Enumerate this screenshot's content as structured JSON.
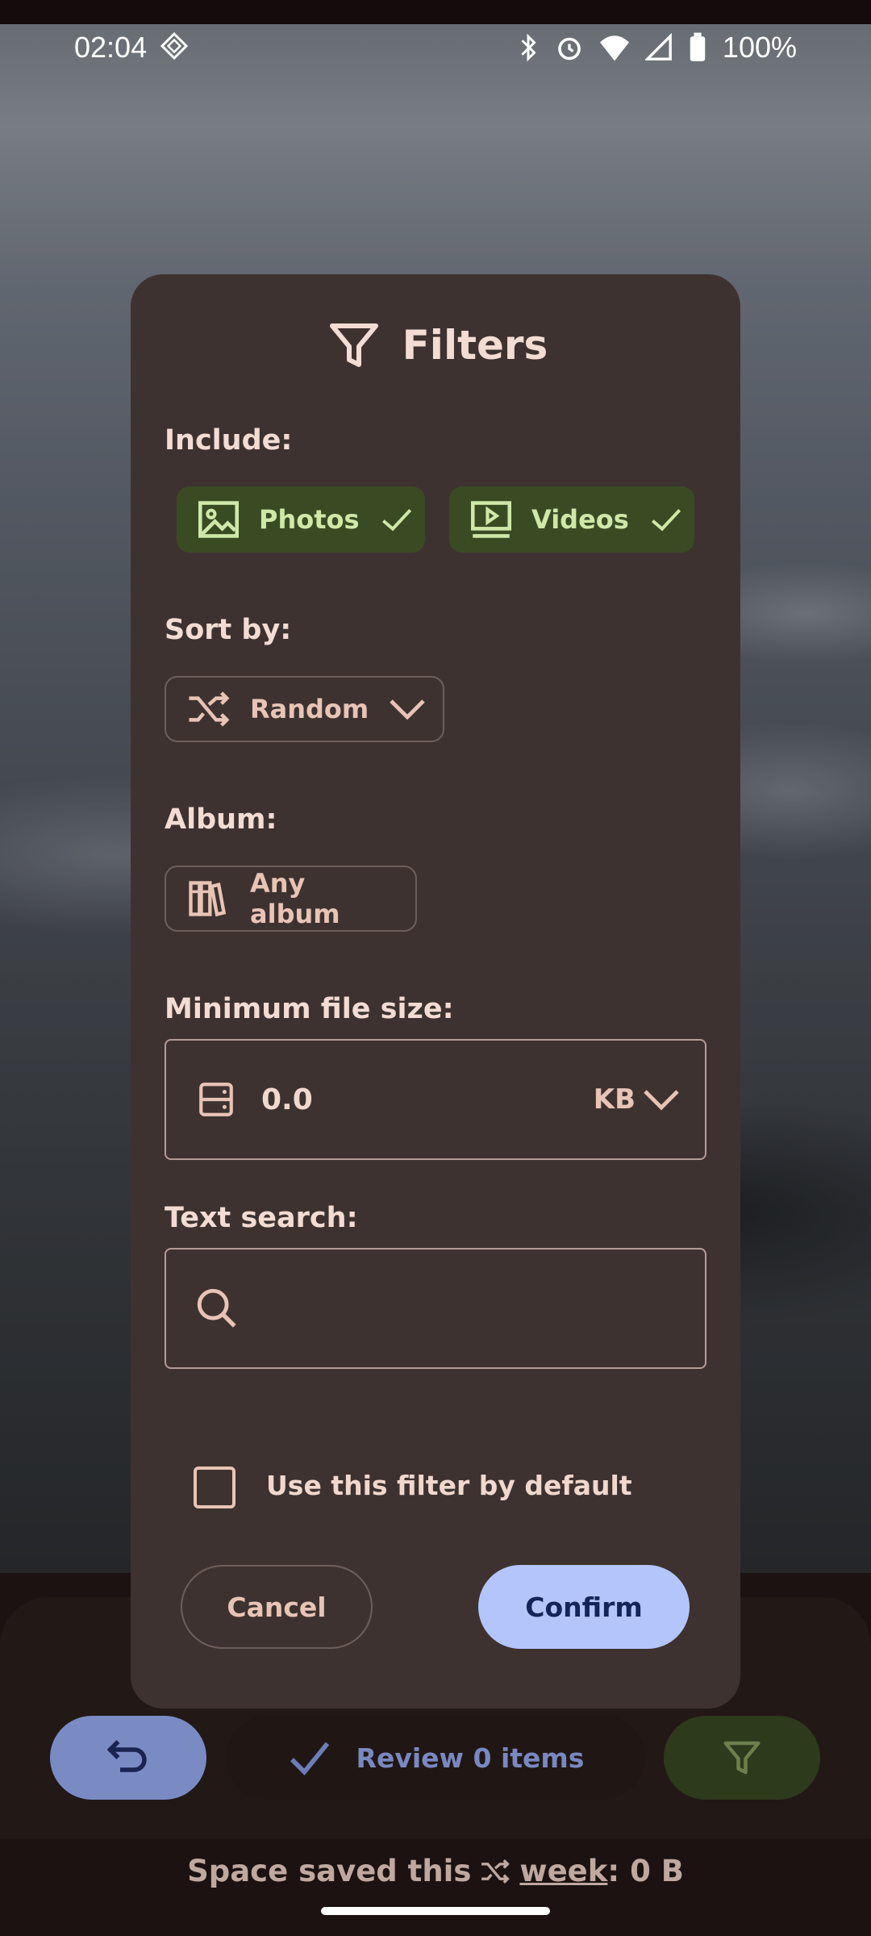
{
  "status_bar": {
    "time": "02:04",
    "battery": "100%"
  },
  "dialog": {
    "title": "Filters",
    "include_label": "Include:",
    "include_chips": [
      {
        "label": "Photos",
        "selected": true
      },
      {
        "label": "Videos",
        "selected": true
      }
    ],
    "sort_label": "Sort by:",
    "sort_value": "Random",
    "album_label": "Album:",
    "album_value": "Any album",
    "min_size_label": "Minimum file size:",
    "min_size_value": "0.0",
    "min_size_unit": "KB",
    "text_search_label": "Text search:",
    "text_search_value": "",
    "default_checkbox_label": "Use this filter by default",
    "default_checkbox_checked": false,
    "cancel_label": "Cancel",
    "confirm_label": "Confirm"
  },
  "bottom": {
    "review_label": "Review 0 items",
    "space_saved_prefix": "Space saved this",
    "space_saved_period": "week",
    "space_saved_value": ": 0 B"
  },
  "colors": {
    "dialog_bg": "#3e3230",
    "chip_selected_bg": "#3a4b24",
    "confirm_bg": "#b4c5fb",
    "back_btn_bg": "#7a8bc4",
    "filter_btn_bg": "#2d3a1c"
  }
}
